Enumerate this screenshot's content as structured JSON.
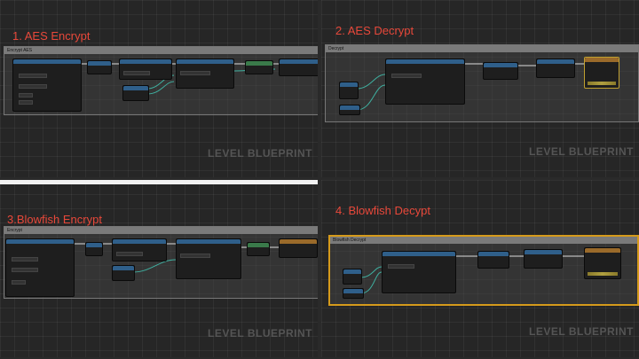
{
  "panels": [
    {
      "heading": "1. AES Encrypt",
      "comment_title": "Encrypt AES",
      "watermark": "LEVEL BLUEPRINT"
    },
    {
      "heading": "2. AES Decrypt",
      "comment_title": "Decrypt",
      "watermark": "LEVEL BLUEPRINT"
    },
    {
      "heading": "3.Blowfish Encrypt",
      "comment_title": "Encrypt",
      "watermark": "LEVEL BLUEPRINT"
    },
    {
      "heading": "4. Blowfish Decypt",
      "comment_title": "Blowfish Decrypt",
      "watermark": "LEVEL BLUEPRINT"
    }
  ],
  "colors": {
    "heading": "#e8483a",
    "selection": "#d59a1b",
    "node_header": "#2f5f8a"
  }
}
